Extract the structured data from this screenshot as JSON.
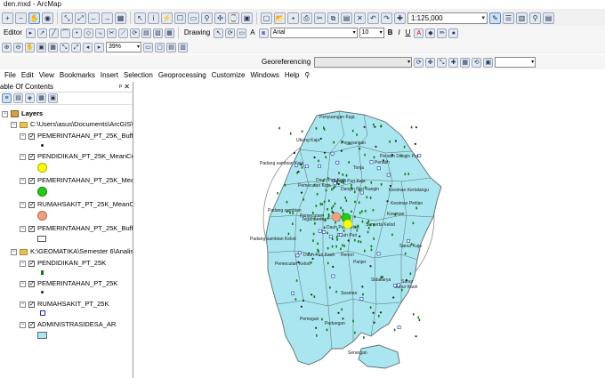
{
  "window": {
    "title": "den.mxd - ArcMap"
  },
  "toolbar": {
    "scale": "1:125,000",
    "editor_label": "Editor",
    "zoom_percent": "39%",
    "drawing_label": "Drawing",
    "font_name": "Arial",
    "font_size": "10",
    "bold": "B",
    "italic": "I",
    "underline": "U",
    "text_tool": "A",
    "georeferencing_label": "Georeferencing"
  },
  "menu": {
    "items": [
      "File",
      "Edit",
      "View",
      "Bookmarks",
      "Insert",
      "Selection",
      "Geoprocessing",
      "Customize",
      "Windows",
      "Help"
    ]
  },
  "toc": {
    "title": "able Of Contents",
    "pin": "ᵖ",
    "close": "✕",
    "root": "Layers",
    "group1_path": "C:\\Users\\asus\\Documents\\ArcGIS\\",
    "group1_layers": [
      "PEMERINTAHAN_PT_25K_Buffer",
      "PENDIDIKAN_PT_25K_MeanCen",
      "PEMERINTAHAN_PT_25K_Mean",
      "RUMAHSAKIT_PT_25K_MeanCe",
      "PEMERINTAHAN_PT_25K_Buffe"
    ],
    "group2_path": "K:\\GEOMATIKA\\Semester 6\\Analisi",
    "group2_layers": [
      "PENDIDIKAN_PT_25K",
      "PEMERINTAHAN_PT_25K",
      "RUMAHSAKIT_PT_25K",
      "ADMINISTRASIDESA_AR"
    ]
  },
  "colors": {
    "polygon_fill": "#a9e6ef",
    "polygon_edge": "#5a6d72",
    "mean_yellow": "#ffff00",
    "mean_green": "#22cc11",
    "mean_salmon": "#f0a080",
    "point_green": "#0a7a0a",
    "point_blue": "#2030b0"
  },
  "map_labels": [
    "Penyuangan Kaja",
    "Ubung Kaja",
    "Peguyangan",
    "Padang sambian Kaja",
    "Tonja",
    "Penatih",
    "Penatih Dangin Puri",
    "Dauh Puri Kaja",
    "Dangin Puri Kaja",
    "Pemecutan Kaja",
    "Dangin Puri Kangin",
    "Kesiman Kertalangu",
    "Kesiman Petilan",
    "Kesiman",
    "Padang sambian",
    "Pemecutan",
    "Dauh Puri Kelod",
    "Sumerta Kelod",
    "Padang sambian Kelod",
    "Pemecutan Kelod",
    "Dauh Puri Kauh",
    "Renon",
    "Panjer",
    "Sanur Kaja",
    "Sanur Kauh",
    "Sanur",
    "Sesetan",
    "Sidakarya",
    "Pemogan",
    "Pedungan",
    "Serangan",
    "Tegal Kertha",
    "Dauh Puri"
  ]
}
